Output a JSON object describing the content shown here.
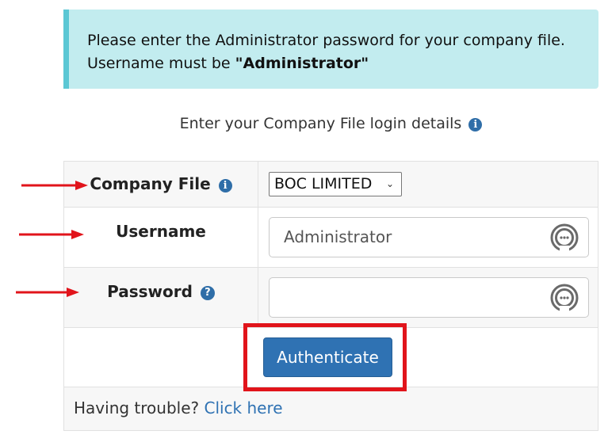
{
  "alert": {
    "line1": "Please enter the Administrator password for your company file.",
    "line2_prefix": "Username must be ",
    "line2_bold": "\"Administrator\""
  },
  "subtitle": {
    "text": "Enter your Company File login details",
    "icon": "info-icon"
  },
  "form": {
    "company_file": {
      "label": "Company File",
      "icon": "info-icon",
      "selected": "BOC LIMITED"
    },
    "username": {
      "label": "Username",
      "value": "Administrator"
    },
    "password": {
      "label": "Password",
      "icon": "question-icon",
      "value": ""
    },
    "authenticate_label": "Authenticate"
  },
  "trouble": {
    "text": "Having trouble?",
    "link": "Click here"
  },
  "annotations": {
    "arrow_color": "#e1141b",
    "highlight_color": "#e1141b"
  },
  "colors": {
    "alert_bg": "#c2ecef",
    "alert_border": "#5bc7d4",
    "primary": "#2f72b3"
  }
}
